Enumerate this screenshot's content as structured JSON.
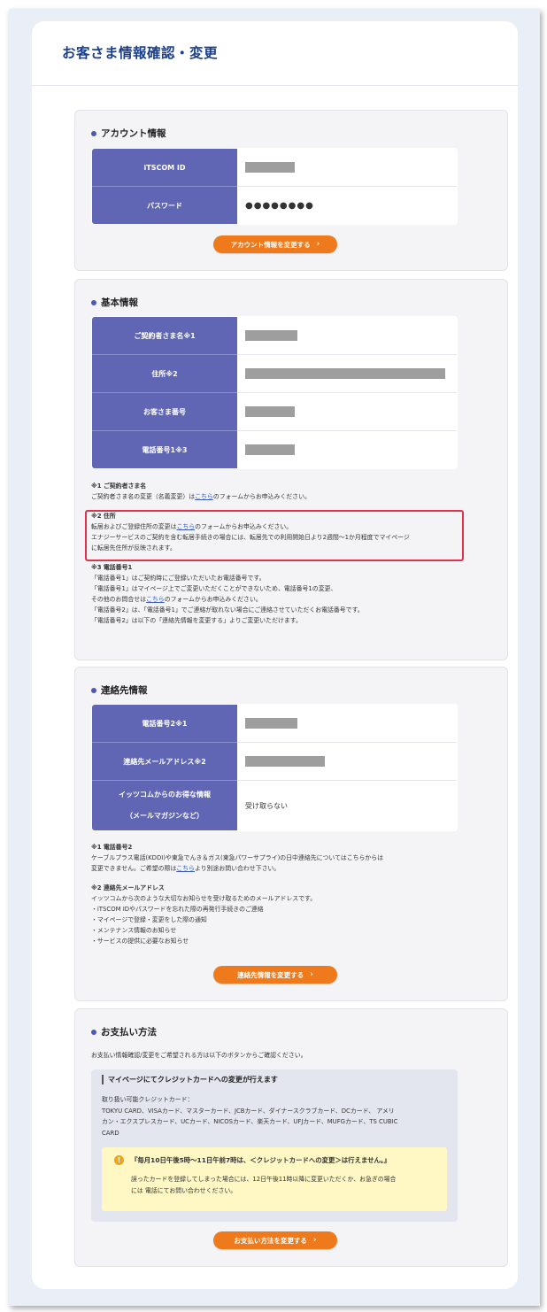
{
  "page_title": "お客さま情報確認・変更",
  "account": {
    "heading": "アカウント情報",
    "rows": [
      {
        "label": "iTSCOM ID",
        "value": ""
      },
      {
        "label": "パスワード",
        "value": "●●●●●●●●"
      }
    ],
    "button": "アカウント情報を変更する"
  },
  "basic": {
    "heading": "基本情報",
    "rows": [
      {
        "label": "ご契約者さま名※1",
        "value": ""
      },
      {
        "label": "住所※2",
        "value": ""
      },
      {
        "label": "お客さま番号",
        "value": ""
      },
      {
        "label": "電話番号1※3",
        "value": ""
      }
    ],
    "note1": {
      "title": "※1 ご契約者さま名",
      "pre": "ご契約者さま名の変更（名義変更）は",
      "link": "こちら",
      "post": "のフォームからお申込みください。"
    },
    "note2": {
      "title": "※2 住所",
      "l1_pre": "転居およびご登録住所の変更は",
      "l1_link": "こちら",
      "l1_post": "のフォームからお申込みください。",
      "l2": "エナジーサービスのご契約を含む転居手続きの場合には、転居先での利用開始日より2週間～1か月程度でマイページ",
      "l3": "に転居先住所が反映されます。"
    },
    "note3": {
      "title": "※3 電話番号1",
      "l1": "「電話番号1」はご契約時にご登録いただいたお電話番号です。",
      "l2": "「電話番号1」はマイページ上でご変更いただくことができないため、電話番号1の変更、",
      "l3_pre": "その他のお問合せは",
      "l3_link": "こちら",
      "l3_post": "のフォームからお申込みください。",
      "l4": "「電話番号2」は、「電話番号1」でご連絡が取れない場合にご連絡させていただくお電話番号です。",
      "l5": "「電話番号2」は以下の「連絡先情報を変更する」よりご変更いただけます。"
    }
  },
  "contact": {
    "heading": "連絡先情報",
    "rows": [
      {
        "label": "電話番号2※1",
        "value": ""
      },
      {
        "label": "連絡先メールアドレス※2",
        "value": ""
      },
      {
        "label1": "イッツコムからのお得な情報",
        "label2": "（メールマガジンなど）",
        "value": "受け取らない"
      }
    ],
    "note1": {
      "title": "※1 電話番号2",
      "l1": "ケーブルプラス電話(KDDI)や東急でんき＆ガス(東急パワーサプライ)の日中連絡先についてはこちらからは",
      "l2_pre": "変更できません。ご希望の際は",
      "l2_link": "こちら",
      "l2_post": "より別途お問い合わせ下さい。"
    },
    "note2": {
      "title": "※2 連絡先メールアドレス",
      "l1": "イッツコムから次のような大切なお知らせを受け取るためのメールアドレスです。",
      "items": [
        "・iTSCOM IDやパスワードを忘れた際の再発行手続きのご連絡",
        "・マイページで登録・変更をした際の通知",
        "・メンテナンス情報のお知らせ",
        "・サービスの提供に必要なお知らせ"
      ]
    },
    "button": "連絡先情報を変更する"
  },
  "payment": {
    "heading": "お支払い方法",
    "intro": "お支払い情報確認/変更をご希望される方は以下のボタンからご確認ください。",
    "cc_title": "マイページにてクレジットカードへの変更が行えます",
    "cc_lines": [
      "取り扱い可能クレジットカード：",
      "TOKYU CARD、VISAカード、マスターカード、JCBカード、ダイナースクラブカード、DCカード、 アメリ",
      "カン・エクスプレスカード、UCカード、NICOSカード、楽天カード、UFJカード、MUFGカード、TS CUBIC",
      "CARD"
    ],
    "warn_title": "『毎月10日午後5時～11日午前7時は、＜クレジットカードへの変更＞は行えません。』",
    "warn_l1": "誤ったカードを登録してしまった場合には、12日午後11時以降に変更いただくか、お急ぎの場合",
    "warn_l2": "には 電話にてお問い合わせください。",
    "button": "お支払い方法を変更する"
  }
}
